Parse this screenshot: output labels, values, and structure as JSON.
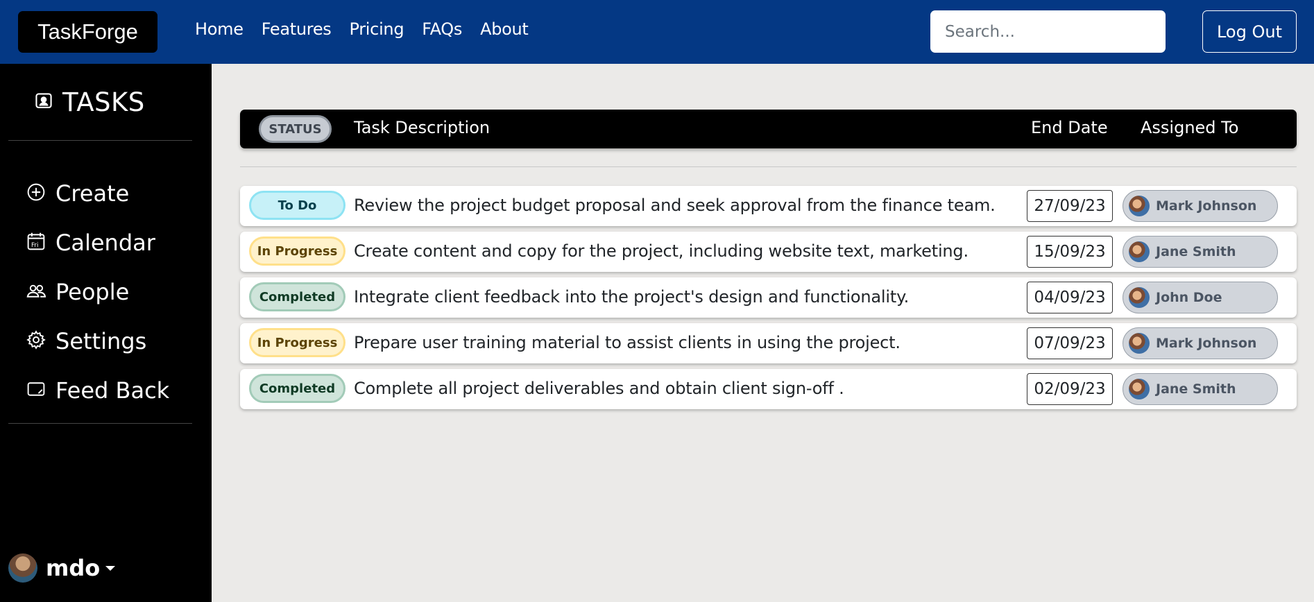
{
  "navbar": {
    "brand": "TaskForge",
    "links": [
      "Home",
      "Features",
      "Pricing",
      "FAQs",
      "About"
    ],
    "search_placeholder": "Search...",
    "logout": "Log Out"
  },
  "sidebar": {
    "title": "TASKS",
    "items": [
      {
        "label": "Create",
        "icon": "plus-circle-icon"
      },
      {
        "label": "Calendar",
        "icon": "calendar-icon"
      },
      {
        "label": "People",
        "icon": "people-icon"
      },
      {
        "label": "Settings",
        "icon": "gear-icon"
      },
      {
        "label": "Feed Back",
        "icon": "feedback-icon"
      }
    ],
    "user": "mdo"
  },
  "table": {
    "headers": {
      "status": "STATUS",
      "description": "Task Description",
      "end_date": "End Date",
      "assigned_to": "Assigned To"
    },
    "rows": [
      {
        "status": "To Do",
        "description": "Review the project budget proposal and seek approval from the finance team.",
        "end_date": "27/09/23",
        "assignee": "Mark Johnson"
      },
      {
        "status": "In Progress",
        "description": "Create content and copy for the project, including website text, marketing.",
        "end_date": "15/09/23",
        "assignee": "Jane Smith"
      },
      {
        "status": "Completed",
        "description": "Integrate client feedback into the project's design and functionality.",
        "end_date": "04/09/23",
        "assignee": "John Doe"
      },
      {
        "status": "In Progress",
        "description": "Prepare user training material to assist clients in using the project.",
        "end_date": "07/09/23",
        "assignee": "Mark Johnson"
      },
      {
        "status": "Completed",
        "description": "Complete all project deliverables and obtain client sign-off .",
        "end_date": "02/09/23",
        "assignee": "Jane Smith"
      }
    ]
  },
  "colors": {
    "navbar": "#043884",
    "sidebar": "#000000",
    "background": "#ebeae8"
  }
}
